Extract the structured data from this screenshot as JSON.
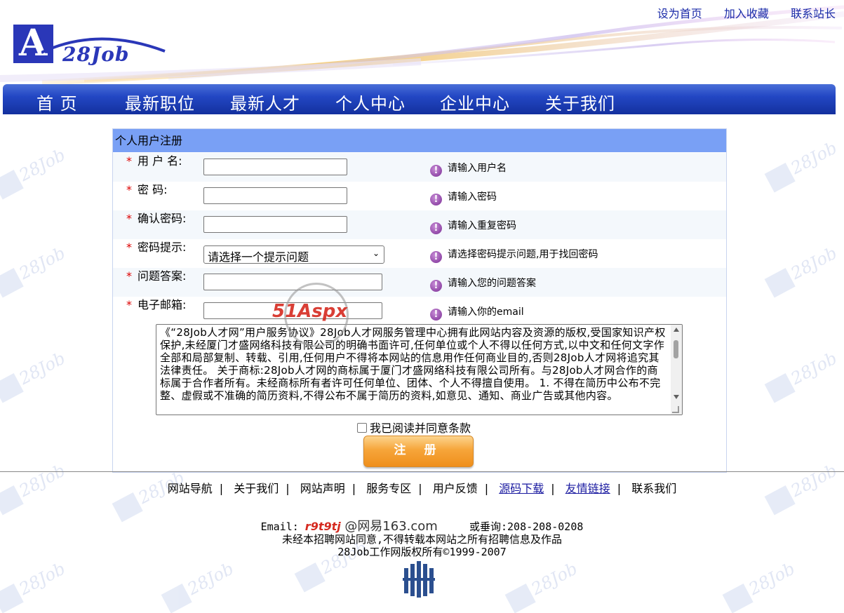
{
  "header": {
    "logo_text": "28Job",
    "top_links": [
      "设为首页",
      "加入收藏",
      "联系站长"
    ]
  },
  "nav": [
    "首 页",
    "最新职位",
    "最新人才",
    "个人中心",
    "企业中心",
    "关于我们"
  ],
  "form": {
    "title": "个人用户注册",
    "fields": [
      {
        "label": "用 户 名:",
        "hint": "请输入用户名"
      },
      {
        "label": "密 码:",
        "hint": "请输入密码"
      },
      {
        "label": "确认密码:",
        "hint": "请输入重复密码"
      },
      {
        "label": "密码提示:",
        "hint": "请选择密码提示问题,用于找回密码",
        "select_value": "请选择一个提示问题"
      },
      {
        "label": "问题答案:",
        "hint": "请输入您的问题答案"
      },
      {
        "label": "电子邮箱:",
        "hint": "请输入你的email"
      }
    ],
    "agreement_text": "《“28Job人才网”用户服务协议》28Job人才网服务管理中心拥有此网站内容及资源的版权,受国家知识产权保护,未经厦门才盛网络科技有限公司的明确书面许可,任何单位或个人不得以任何方式,以中文和任何文字作全部和局部复制、转载、引用,任何用户不得将本网站的信息用作任何商业目的,否则28Job人才网将追究其法律责任。 关于商标:28Job人才网的商标属于厦门才盛网络科技有限公司所有。与28Job人才网合作的商标属于合作者所有。未经商标所有者许可任何单位、团体、个人不得擅自使用。 1. 不得在简历中公布不完整、虚假或不准确的简历资料,不得公布不属于简历的资料,如意见、通知、商业广告或其他内容。",
    "agree_label": "我已阅读并同意条款",
    "submit_label": "注 册"
  },
  "watermark_stamp": "51Aspx",
  "footer": {
    "links": [
      "网站导航",
      "关于我们",
      "网站声明",
      "服务专区",
      "用户反馈",
      "源码下载",
      "友情链接",
      "联系我们"
    ],
    "email_prefix": "Email:",
    "email_user": "r9t9tj",
    "email_domain": "@网易163.com",
    "phone": "或垂询:208-208-0208",
    "notice": "未经本招聘网站同意,不得转载本网站之所有招聘信息及作品",
    "copyright": "28Job工作网版权所有©1999-2007"
  },
  "colors": {
    "nav_blue": "#2347c4",
    "form_title_bg": "#79a0f5",
    "button_orange": "#f6a53a",
    "required_star": "#dd0000"
  }
}
